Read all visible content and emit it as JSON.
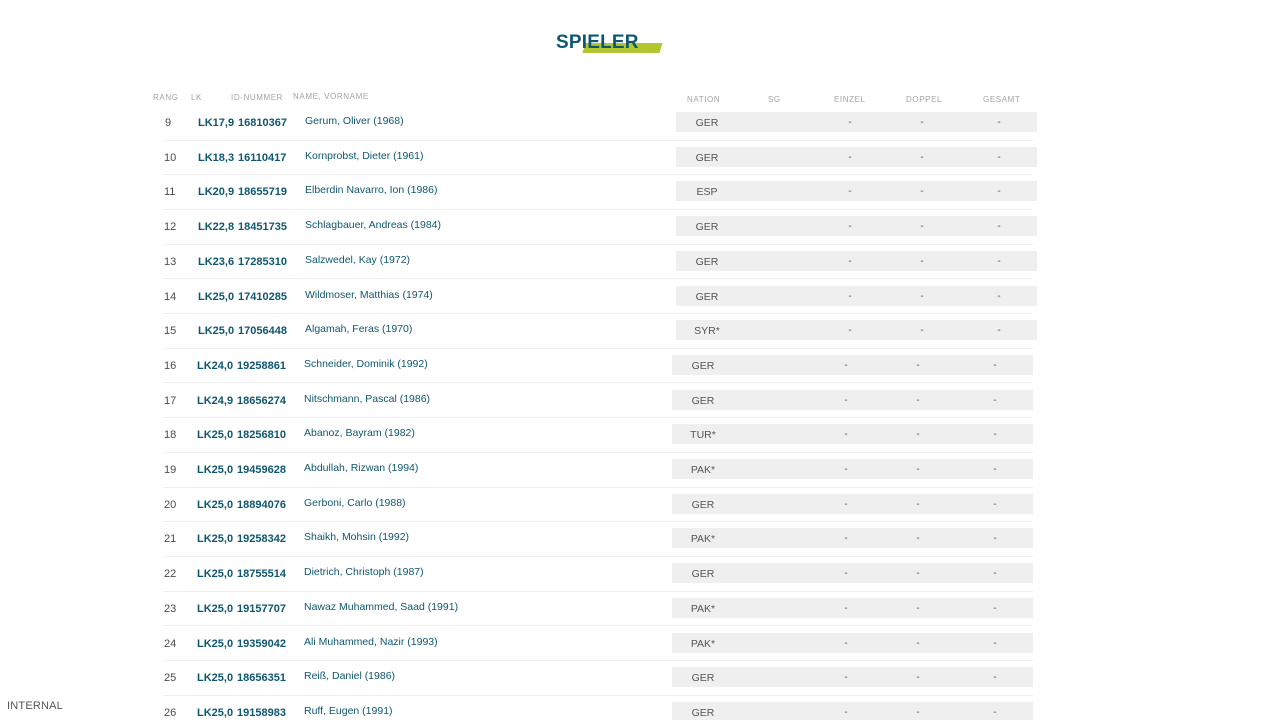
{
  "header": {
    "title": "SPIELER"
  },
  "columns": {
    "rang": "RANG",
    "lk": "LK",
    "id": "ID-NUMMER",
    "name": "NAME, VORNAME",
    "nation": "NATION",
    "sg": "SG",
    "einzel": "EINZEL",
    "doppel": "DOPPEL",
    "gesamt": "GESAMT"
  },
  "rows": [
    {
      "rang": "9",
      "lk": "LK17,9",
      "id": "16810367",
      "name": "Gerum, Oliver (1968)",
      "nation": "GER",
      "einzel": "-",
      "doppel": "-",
      "gesamt": "-"
    },
    {
      "rang": "10",
      "lk": "LK18,3",
      "id": "16110417",
      "name": "Kornprobst, Dieter (1961)",
      "nation": "GER",
      "einzel": "-",
      "doppel": "-",
      "gesamt": "-"
    },
    {
      "rang": "11",
      "lk": "LK20,9",
      "id": "18655719",
      "name": "Elberdin Navarro, Ion (1986)",
      "nation": "ESP",
      "einzel": "-",
      "doppel": "-",
      "gesamt": "-"
    },
    {
      "rang": "12",
      "lk": "LK22,8",
      "id": "18451735",
      "name": "Schlagbauer, Andreas (1984)",
      "nation": "GER",
      "einzel": "-",
      "doppel": "-",
      "gesamt": "-"
    },
    {
      "rang": "13",
      "lk": "LK23,6",
      "id": "17285310",
      "name": "Salzwedel, Kay (1972)",
      "nation": "GER",
      "einzel": "-",
      "doppel": "-",
      "gesamt": "-"
    },
    {
      "rang": "14",
      "lk": "LK25,0",
      "id": "17410285",
      "name": "Wildmoser, Matthias (1974)",
      "nation": "GER",
      "einzel": "-",
      "doppel": "-",
      "gesamt": "-"
    },
    {
      "rang": "15",
      "lk": "LK25,0",
      "id": "17056448",
      "name": "Algamah, Feras (1970)",
      "nation": "SYR*",
      "einzel": "-",
      "doppel": "-",
      "gesamt": "-"
    },
    {
      "rang": "16",
      "lk": "LK24,0",
      "id": "19258861",
      "name": "Schneider, Dominik (1992)",
      "nation": "GER",
      "einzel": "-",
      "doppel": "-",
      "gesamt": "-"
    },
    {
      "rang": "17",
      "lk": "LK24,9",
      "id": "18656274",
      "name": "Nitschmann, Pascal (1986)",
      "nation": "GER",
      "einzel": "-",
      "doppel": "-",
      "gesamt": "-"
    },
    {
      "rang": "18",
      "lk": "LK25,0",
      "id": "18256810",
      "name": "Abanoz, Bayram (1982)",
      "nation": "TUR*",
      "einzel": "-",
      "doppel": "-",
      "gesamt": "-"
    },
    {
      "rang": "19",
      "lk": "LK25,0",
      "id": "19459628",
      "name": "Abdullah, Rizwan (1994)",
      "nation": "PAK*",
      "einzel": "-",
      "doppel": "-",
      "gesamt": "-"
    },
    {
      "rang": "20",
      "lk": "LK25,0",
      "id": "18894076",
      "name": "Gerboni, Carlo (1988)",
      "nation": "GER",
      "einzel": "-",
      "doppel": "-",
      "gesamt": "-"
    },
    {
      "rang": "21",
      "lk": "LK25,0",
      "id": "19258342",
      "name": "Shaikh, Mohsin (1992)",
      "nation": "PAK*",
      "einzel": "-",
      "doppel": "-",
      "gesamt": "-"
    },
    {
      "rang": "22",
      "lk": "LK25,0",
      "id": "18755514",
      "name": "Dietrich, Christoph (1987)",
      "nation": "GER",
      "einzel": "-",
      "doppel": "-",
      "gesamt": "-"
    },
    {
      "rang": "23",
      "lk": "LK25,0",
      "id": "19157707",
      "name": "Nawaz Muhammed, Saad (1991)",
      "nation": "PAK*",
      "einzel": "-",
      "doppel": "-",
      "gesamt": "-"
    },
    {
      "rang": "24",
      "lk": "LK25,0",
      "id": "19359042",
      "name": "Ali Muhammed, Nazir (1993)",
      "nation": "PAK*",
      "einzel": "-",
      "doppel": "-",
      "gesamt": "-"
    },
    {
      "rang": "25",
      "lk": "LK25,0",
      "id": "18656351",
      "name": "Reiß, Daniel (1986)",
      "nation": "GER",
      "einzel": "-",
      "doppel": "-",
      "gesamt": "-"
    },
    {
      "rang": "26",
      "lk": "LK25,0",
      "id": "19158983",
      "name": "Ruff, Eugen (1991)",
      "nation": "GER",
      "einzel": "-",
      "doppel": "-",
      "gesamt": "-"
    }
  ],
  "footer": {
    "label": "INTERNAL"
  }
}
